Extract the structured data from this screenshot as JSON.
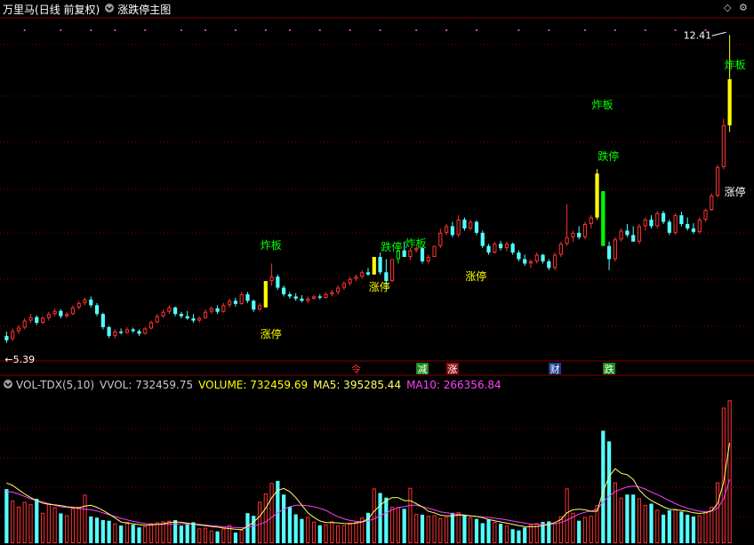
{
  "header": {
    "stock_name": "万里马",
    "period_label": "(日线 前复权)",
    "indicator_title": "涨跌停主图",
    "corner_icon_1": "diamond-icon",
    "corner_icon_2": "gear-icon"
  },
  "price_panel": {
    "high_label": "12.41",
    "low_label": "5.39"
  },
  "annotations": [
    {
      "text": "涨停",
      "color": "#ffff00"
    },
    {
      "text": "炸板",
      "color": "#00ff00"
    },
    {
      "text": "涨停",
      "color": "#ffff00"
    },
    {
      "text": "跌停",
      "color": "#00ff00"
    },
    {
      "text": "炸板",
      "color": "#00ff00"
    },
    {
      "text": "涨停",
      "color": "#ffff00"
    },
    {
      "text": "炸板",
      "color": "#00ff00"
    },
    {
      "text": "跌停",
      "color": "#00ff00"
    },
    {
      "text": "炸板",
      "color": "#00ff00"
    },
    {
      "text": "涨停",
      "color": "#ffffff"
    }
  ],
  "event_markers": [
    {
      "text": "令",
      "bg": "#000000",
      "color": "#ff3030"
    },
    {
      "text": "减",
      "bg": "#1b8a1b",
      "color": "#ffffff"
    },
    {
      "text": "涨",
      "bg": "#8a1010",
      "color": "#ffffff"
    },
    {
      "text": "财",
      "bg": "#1a3f8a",
      "color": "#ffffff"
    },
    {
      "text": "跌",
      "bg": "#1b8a1b",
      "color": "#ffffff"
    }
  ],
  "volume_header": {
    "name": "VOL-TDX(5,10)",
    "vvol": "VVOL: 732459.75",
    "volume": "VOLUME: 732459.69",
    "ma5": "MA5: 395285.44",
    "ma10": "MA10: 266356.84"
  },
  "colors": {
    "up": "#ff3232",
    "down": "#54ffff",
    "grid": "#800000",
    "limit_up": "#ffff00",
    "limit_down": "#00ff00",
    "ma5": "#ffff66",
    "ma10": "#ff40ff",
    "vvol": "#c0c0c0",
    "volume": "#ffff00",
    "ma10_text": "#ff40ff"
  },
  "chart_data": {
    "type": "candlestick",
    "price_range": [
      5.39,
      12.41
    ],
    "candles": [
      [
        5.55,
        5.65,
        5.39,
        5.45
      ],
      [
        5.48,
        5.72,
        5.44,
        5.66
      ],
      [
        5.66,
        5.8,
        5.6,
        5.74
      ],
      [
        5.74,
        5.95,
        5.7,
        5.9
      ],
      [
        5.9,
        6.05,
        5.85,
        5.98
      ],
      [
        5.98,
        6.02,
        5.8,
        5.85
      ],
      [
        5.85,
        6.0,
        5.82,
        5.96
      ],
      [
        5.96,
        6.1,
        5.9,
        6.05
      ],
      [
        6.05,
        6.18,
        6.0,
        6.12
      ],
      [
        6.12,
        6.16,
        5.95,
        6.0
      ],
      [
        6.0,
        6.1,
        5.96,
        6.05
      ],
      [
        6.05,
        6.25,
        6.02,
        6.2
      ],
      [
        6.2,
        6.35,
        6.15,
        6.3
      ],
      [
        6.3,
        6.42,
        6.25,
        6.38
      ],
      [
        6.38,
        6.45,
        6.2,
        6.25
      ],
      [
        6.25,
        6.3,
        6.0,
        6.05
      ],
      [
        6.05,
        6.08,
        5.7,
        5.75
      ],
      [
        5.75,
        5.78,
        5.5,
        5.55
      ],
      [
        5.55,
        5.7,
        5.5,
        5.65
      ],
      [
        5.65,
        5.72,
        5.58,
        5.62
      ],
      [
        5.62,
        5.75,
        5.6,
        5.7
      ],
      [
        5.7,
        5.74,
        5.62,
        5.66
      ],
      [
        5.66,
        5.7,
        5.55,
        5.6
      ],
      [
        5.6,
        5.75,
        5.58,
        5.72
      ],
      [
        5.72,
        5.9,
        5.7,
        5.86
      ],
      [
        5.86,
        6.05,
        5.84,
        6.0
      ],
      [
        6.0,
        6.15,
        5.96,
        6.1
      ],
      [
        6.1,
        6.25,
        6.05,
        6.2
      ],
      [
        6.2,
        6.22,
        6.0,
        6.05
      ],
      [
        6.05,
        6.1,
        5.95,
        6.0
      ],
      [
        6.0,
        6.12,
        5.92,
        5.95
      ],
      [
        5.95,
        6.05,
        5.85,
        5.9
      ],
      [
        5.9,
        6.0,
        5.86,
        5.96
      ],
      [
        5.96,
        6.15,
        5.94,
        6.1
      ],
      [
        6.1,
        6.22,
        6.05,
        6.18
      ],
      [
        6.18,
        6.25,
        6.05,
        6.1
      ],
      [
        6.1,
        6.3,
        6.08,
        6.25
      ],
      [
        6.25,
        6.4,
        6.2,
        6.35
      ],
      [
        6.35,
        6.42,
        6.22,
        6.28
      ],
      [
        6.28,
        6.55,
        6.26,
        6.5
      ],
      [
        6.5,
        6.55,
        6.3,
        6.35
      ],
      [
        6.35,
        6.38,
        6.1,
        6.15
      ],
      [
        6.15,
        6.3,
        6.12,
        6.25
      ],
      [
        6.2,
        6.8,
        6.2,
        6.8
      ],
      [
        6.8,
        7.2,
        6.7,
        6.9
      ],
      [
        6.9,
        6.95,
        6.6,
        6.65
      ],
      [
        6.65,
        6.7,
        6.45,
        6.5
      ],
      [
        6.5,
        6.55,
        6.4,
        6.45
      ],
      [
        6.45,
        6.52,
        6.35,
        6.4
      ],
      [
        6.4,
        6.48,
        6.32,
        6.35
      ],
      [
        6.35,
        6.45,
        6.3,
        6.4
      ],
      [
        6.4,
        6.48,
        6.38,
        6.45
      ],
      [
        6.45,
        6.5,
        6.38,
        6.42
      ],
      [
        6.42,
        6.55,
        6.4,
        6.5
      ],
      [
        6.5,
        6.6,
        6.45,
        6.55
      ],
      [
        6.55,
        6.7,
        6.5,
        6.65
      ],
      [
        6.65,
        6.8,
        6.6,
        6.75
      ],
      [
        6.75,
        6.9,
        6.7,
        6.85
      ],
      [
        6.85,
        6.95,
        6.8,
        6.9
      ],
      [
        6.9,
        7.05,
        6.85,
        7.0
      ],
      [
        7.0,
        7.1,
        6.92,
        6.95
      ],
      [
        6.95,
        7.35,
        6.95,
        7.35
      ],
      [
        7.35,
        7.45,
        6.95,
        7.0
      ],
      [
        7.0,
        7.3,
        6.6,
        6.8
      ],
      [
        6.8,
        7.3,
        6.78,
        7.3
      ],
      [
        7.3,
        7.6,
        7.2,
        7.5
      ],
      [
        7.5,
        7.7,
        7.4,
        7.35
      ],
      [
        7.35,
        7.55,
        7.28,
        7.5
      ],
      [
        7.5,
        7.6,
        7.45,
        7.55
      ],
      [
        7.55,
        7.58,
        7.2,
        7.25
      ],
      [
        7.25,
        7.4,
        7.2,
        7.35
      ],
      [
        7.35,
        7.6,
        7.35,
        7.6
      ],
      [
        7.6,
        8.0,
        7.55,
        7.9
      ],
      [
        7.9,
        8.1,
        7.85,
        8.05
      ],
      [
        8.05,
        8.15,
        7.8,
        7.85
      ],
      [
        7.85,
        8.3,
        7.8,
        8.2
      ],
      [
        8.2,
        8.25,
        7.95,
        8.0
      ],
      [
        8.0,
        8.2,
        7.95,
        8.15
      ],
      [
        8.15,
        8.18,
        7.85,
        7.9
      ],
      [
        7.9,
        7.95,
        7.55,
        7.6
      ],
      [
        7.6,
        7.65,
        7.4,
        7.45
      ],
      [
        7.45,
        7.7,
        7.42,
        7.65
      ],
      [
        7.65,
        7.72,
        7.5,
        7.55
      ],
      [
        7.55,
        7.7,
        7.48,
        7.65
      ],
      [
        7.65,
        7.68,
        7.4,
        7.45
      ],
      [
        7.45,
        7.5,
        7.25,
        7.3
      ],
      [
        7.3,
        7.4,
        7.15,
        7.2
      ],
      [
        7.2,
        7.3,
        7.1,
        7.25
      ],
      [
        7.25,
        7.45,
        7.2,
        7.4
      ],
      [
        7.4,
        7.42,
        7.2,
        7.25
      ],
      [
        7.25,
        7.3,
        7.05,
        7.1
      ],
      [
        7.1,
        7.45,
        7.05,
        7.4
      ],
      [
        7.4,
        7.7,
        7.35,
        7.65
      ],
      [
        7.65,
        8.55,
        7.6,
        7.8
      ],
      [
        7.8,
        7.95,
        7.7,
        7.9
      ],
      [
        7.9,
        8.05,
        7.75,
        7.8
      ],
      [
        7.8,
        8.15,
        7.75,
        8.1
      ],
      [
        8.1,
        8.3,
        8.0,
        8.25
      ],
      [
        8.25,
        9.35,
        8.2,
        9.25
      ],
      [
        8.85,
        8.85,
        7.6,
        7.6
      ],
      [
        7.6,
        7.7,
        7.05,
        7.3
      ],
      [
        7.3,
        7.8,
        7.25,
        7.75
      ],
      [
        7.75,
        8.0,
        7.7,
        7.95
      ],
      [
        7.95,
        8.1,
        7.8,
        7.85
      ],
      [
        7.85,
        8.05,
        7.7,
        7.7
      ],
      [
        7.7,
        8.1,
        7.65,
        8.05
      ],
      [
        8.05,
        8.25,
        7.95,
        8.2
      ],
      [
        8.2,
        8.3,
        8.0,
        8.05
      ],
      [
        8.05,
        8.4,
        8.0,
        8.35
      ],
      [
        8.35,
        8.4,
        8.1,
        8.15
      ],
      [
        8.15,
        8.2,
        7.85,
        7.9
      ],
      [
        7.9,
        8.35,
        7.85,
        8.3
      ],
      [
        8.3,
        8.38,
        8.05,
        8.1
      ],
      [
        8.1,
        8.25,
        7.95,
        8.0
      ],
      [
        8.0,
        8.12,
        7.88,
        7.92
      ],
      [
        7.92,
        8.25,
        7.88,
        8.2
      ],
      [
        8.2,
        8.45,
        8.15,
        8.42
      ],
      [
        8.42,
        8.8,
        8.4,
        8.75
      ],
      [
        8.75,
        9.45,
        8.7,
        9.4
      ],
      [
        9.4,
        10.5,
        9.35,
        10.35
      ],
      [
        10.35,
        12.41,
        10.2,
        11.4
      ]
    ],
    "volumes": [
      178,
      140,
      120,
      136,
      128,
      146,
      100,
      132,
      118,
      98,
      92,
      115,
      120,
      160,
      88,
      84,
      76,
      74,
      65,
      58,
      70,
      61,
      52,
      56,
      66,
      69,
      72,
      74,
      76,
      58,
      62,
      69,
      49,
      51,
      42,
      39,
      48,
      60,
      35,
      44,
      99,
      90,
      136,
      164,
      198,
      205,
      160,
      120,
      95,
      80,
      86,
      71,
      59,
      62,
      72,
      58,
      60,
      68,
      70,
      84,
      100,
      180,
      165,
      150,
      120,
      118,
      113,
      182,
      96,
      94,
      90,
      92,
      82,
      86,
      100,
      102,
      92,
      85,
      80,
      66,
      78,
      70,
      64,
      58,
      46,
      42,
      52,
      61,
      66,
      70,
      72,
      66,
      88,
      180,
      100,
      74,
      86,
      90,
      125,
      370,
      335,
      200,
      150,
      160,
      160,
      148,
      126,
      130,
      110,
      94,
      108,
      113,
      104,
      94,
      88,
      92,
      102,
      120,
      200,
      446,
      470
    ],
    "ma5": [
      198,
      190,
      176,
      162,
      150,
      140,
      132,
      128,
      126,
      124,
      120,
      118,
      116,
      122,
      125,
      118,
      108,
      96,
      83,
      70,
      66,
      64,
      61,
      59,
      60,
      62,
      64,
      68,
      70,
      69,
      66,
      63,
      60,
      58,
      55,
      53,
      50,
      48,
      46,
      45,
      55,
      70,
      88,
      115,
      150,
      174,
      180,
      170,
      150,
      125,
      100,
      85,
      73,
      68,
      68,
      67,
      65,
      64,
      66,
      70,
      80,
      105,
      125,
      140,
      150,
      150,
      140,
      140,
      130,
      120,
      105,
      100,
      92,
      90,
      90,
      93,
      92,
      90,
      88,
      84,
      78,
      74,
      70,
      66,
      62,
      58,
      55,
      54,
      55,
      58,
      62,
      68,
      78,
      100,
      110,
      112,
      110,
      105,
      105,
      170,
      220,
      245,
      230,
      225,
      210,
      175,
      155,
      140,
      130,
      120,
      112,
      110,
      108,
      105,
      100,
      98,
      100,
      106,
      130,
      200,
      330
    ],
    "ma10": [
      170,
      168,
      162,
      154,
      146,
      140,
      136,
      130,
      125,
      120,
      118,
      116,
      114,
      112,
      110,
      106,
      100,
      94,
      88,
      82,
      77,
      72,
      68,
      65,
      63,
      62,
      62,
      62,
      63,
      64,
      64,
      63,
      62,
      60,
      58,
      56,
      54,
      53,
      52,
      51,
      52,
      56,
      62,
      70,
      85,
      100,
      112,
      120,
      125,
      125,
      123,
      120,
      115,
      108,
      97,
      87,
      80,
      75,
      72,
      71,
      73,
      80,
      90,
      100,
      110,
      118,
      120,
      125,
      125,
      120,
      115,
      110,
      103,
      100,
      97,
      95,
      93,
      90,
      88,
      86,
      85,
      82,
      80,
      77,
      73,
      70,
      66,
      63,
      62,
      62,
      62,
      64,
      68,
      76,
      86,
      96,
      102,
      106,
      112,
      135,
      155,
      170,
      178,
      185,
      188,
      185,
      178,
      168,
      160,
      150,
      140,
      130,
      122,
      115,
      110,
      105,
      104,
      106,
      115,
      145,
      210
    ],
    "limit_up_candles": [
      43,
      61,
      98,
      120
    ],
    "limit_down_candles": [
      65,
      99
    ]
  }
}
